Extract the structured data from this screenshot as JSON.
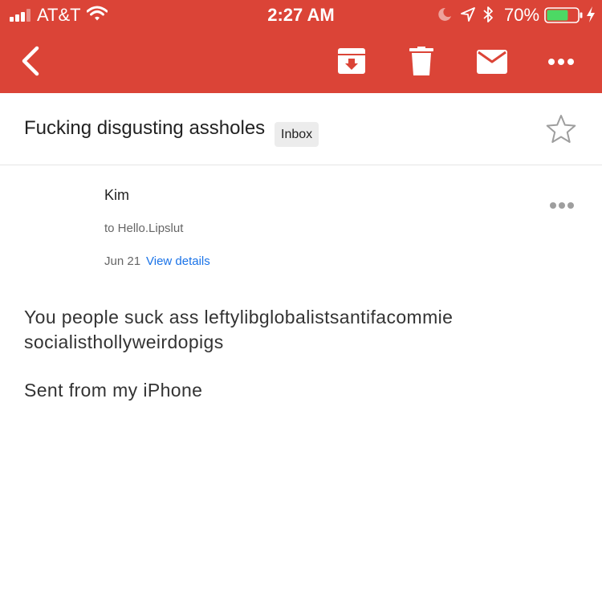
{
  "status_bar": {
    "carrier": "AT&T",
    "time": "2:27 AM",
    "battery_percent": "70%",
    "battery_level": 0.7,
    "signal_bars": 3
  },
  "colors": {
    "app_bar": "#db4437",
    "link": "#1a73e8",
    "battery_fill": "#4cd964"
  },
  "toolbar": {
    "icons": [
      "back-arrow-icon",
      "archive-icon",
      "trash-icon",
      "mail-icon",
      "more-icon"
    ]
  },
  "email": {
    "subject": "Fucking disgusting assholes",
    "label": "Inbox",
    "sender": "Kim",
    "recipient": "to Hello.Lipslut",
    "date": "Jun 21",
    "details_link": "View details",
    "body": "You people suck ass leftylibglobalistsantifacommie socialisthollyweirdopigs",
    "signature": "Sent from my iPhone"
  }
}
